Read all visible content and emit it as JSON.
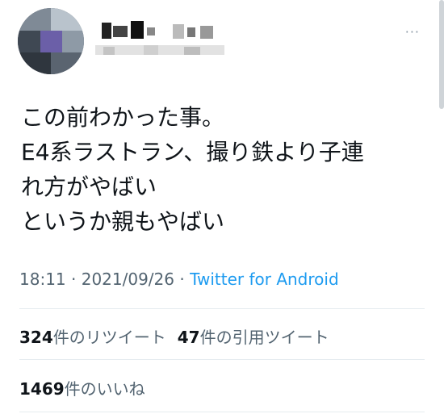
{
  "tweet": {
    "more_icon": "···",
    "text": "この前わかった事。\nE4系ラストラン、撮り鉄より子連\nれ方がやばい\nというか親もやばい",
    "time": "18:11",
    "separator": " · ",
    "date": "2021/09/26",
    "source": "Twitter for Android"
  },
  "stats": {
    "retweets_count": "324",
    "retweets_label": "件のリツイート",
    "quotes_count": "47",
    "quotes_label": "件の引用ツイート",
    "likes_count": "1469",
    "likes_label": "件のいいね"
  },
  "colors": {
    "text": "#0f1419",
    "meta": "#536471",
    "link": "#1d9bf0",
    "divider": "#e6ecf0"
  }
}
